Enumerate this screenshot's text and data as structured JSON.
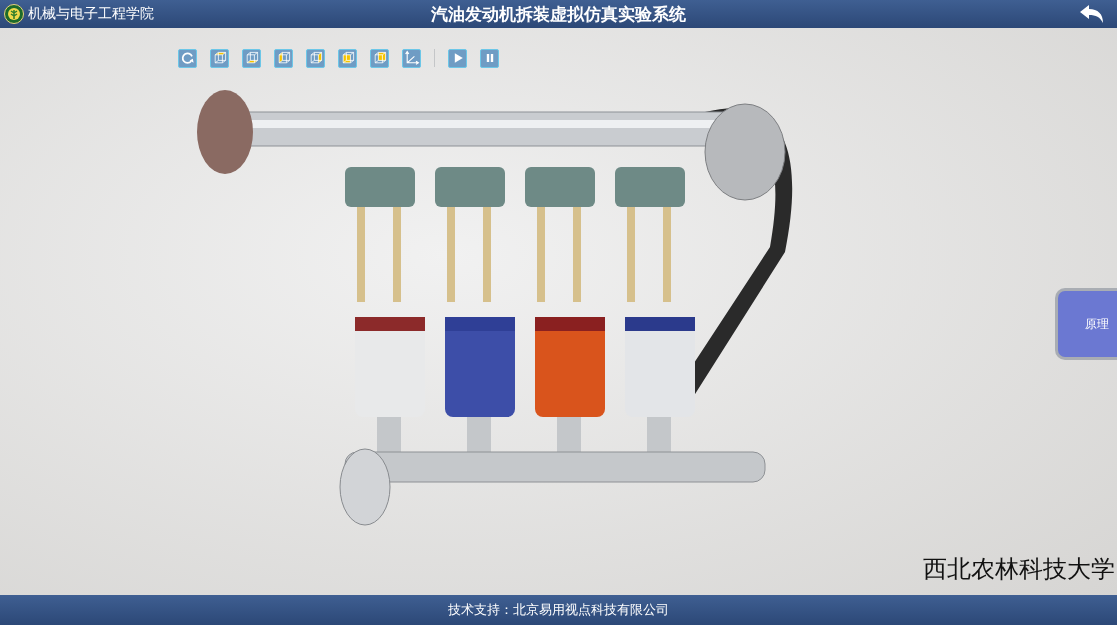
{
  "header": {
    "school": "机械与电子工程学院",
    "title": "汽油发动机拆装虚拟仿真实验系统"
  },
  "toolbar": [
    {
      "kind": "rotate"
    },
    {
      "kind": "cube-top"
    },
    {
      "kind": "cube-bottom"
    },
    {
      "kind": "cube-left"
    },
    {
      "kind": "cube-right"
    },
    {
      "kind": "cube-front"
    },
    {
      "kind": "cube-back"
    },
    {
      "kind": "axes"
    },
    {
      "kind": "divider"
    },
    {
      "kind": "play"
    },
    {
      "kind": "pause"
    }
  ],
  "side_button": "原理",
  "university": "西北农林科技大学",
  "footer": "技术支持：北京易用视点科技有限公司"
}
